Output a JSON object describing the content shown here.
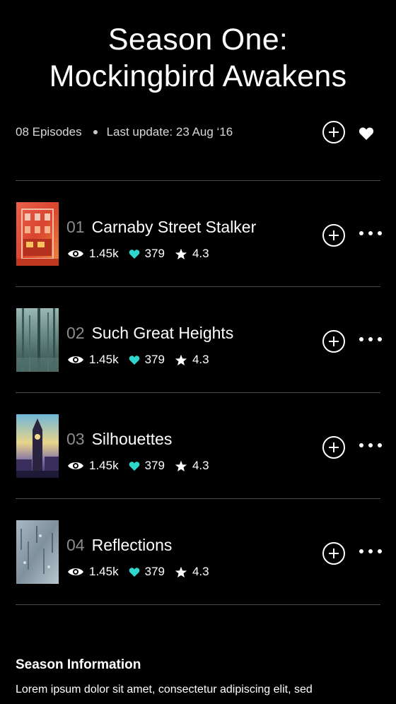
{
  "season": {
    "title_line1": "Season One:",
    "title_line2": "Mockingbird Awakens",
    "episode_count": "08 Episodes",
    "last_update": "Last update: 23 Aug ‘16"
  },
  "colors": {
    "background": "#000000",
    "accent_heart": "#2fd6cb",
    "divider": "#4a4a4a",
    "muted_text": "#8c8c8c"
  },
  "icons": {
    "add": "plus-circle-icon",
    "favorite": "heart-icon",
    "views": "eye-icon",
    "likes": "heart-icon",
    "rating": "star-icon",
    "more": "more-dots-icon"
  },
  "episodes": [
    {
      "number": "01",
      "title": "Carnaby Street Stalker",
      "views": "1.45k",
      "likes": "379",
      "rating": "4.3"
    },
    {
      "number": "02",
      "title": "Such Great Heights",
      "views": "1.45k",
      "likes": "379",
      "rating": "4.3"
    },
    {
      "number": "03",
      "title": "Silhouettes",
      "views": "1.45k",
      "likes": "379",
      "rating": "4.3"
    },
    {
      "number": "04",
      "title": "Reflections",
      "views": "1.45k",
      "likes": "379",
      "rating": "4.3"
    }
  ],
  "season_info": {
    "heading": "Season Information",
    "text": "Lorem ipsum dolor sit amet, consectetur adipiscing elit, sed"
  }
}
